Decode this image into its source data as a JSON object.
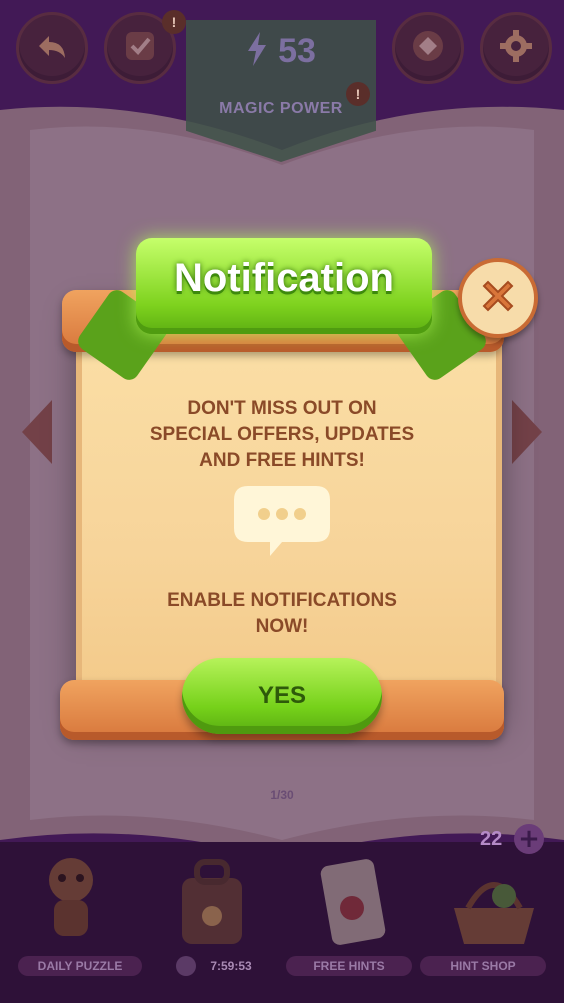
{
  "topbar": {
    "back_icon": "back-arrow-icon",
    "tasks_icon": "checkmark-icon",
    "tasks_badge": "!",
    "magic_power_value": "53",
    "magic_power_label": "MAGIC POWER",
    "magic_power_badge": "!",
    "map_icon": "diamond-icon",
    "settings_icon": "gear-icon"
  },
  "dialog": {
    "title": "Notification",
    "message_line1": "DON'T MISS OUT ON",
    "message_line2": "SPECIAL OFFERS, UPDATES",
    "message_line3": "AND FREE HINTS!",
    "cta_line1": "ENABLE NOTIFICATIONS",
    "cta_line2": "NOW!",
    "yes_label": "YES",
    "close_icon": "close-icon",
    "bubble_icon": "chat-bubble-icon"
  },
  "book": {
    "page_info": "1/30"
  },
  "hints_counter": "22",
  "bottom_nav": {
    "items": [
      {
        "label": "DAILY PUZZLE"
      },
      {
        "label": "7:59:53"
      },
      {
        "label": "FREE HINTS"
      },
      {
        "label": "HINT SHOP"
      }
    ]
  },
  "colors": {
    "accent_green": "#7ed21e",
    "wood": "#d7763b",
    "parchment": "#f7d49a",
    "text_brown": "#8a4a28"
  }
}
